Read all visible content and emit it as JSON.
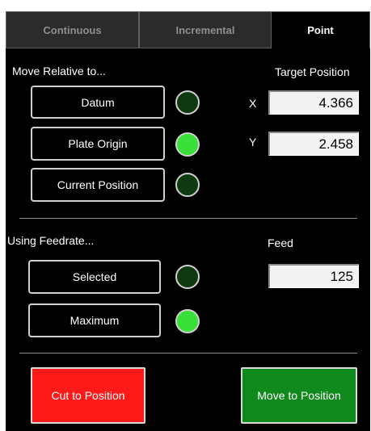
{
  "tabs": [
    {
      "label": "Continuous",
      "active": false
    },
    {
      "label": "Incremental",
      "active": false
    },
    {
      "label": "Point",
      "active": true
    }
  ],
  "move_relative": {
    "heading": "Move Relative to...",
    "options": [
      {
        "label": "Datum",
        "indicator": "off"
      },
      {
        "label": "Plate Origin",
        "indicator": "on"
      },
      {
        "label": "Current Position",
        "indicator": "off"
      }
    ]
  },
  "target_position": {
    "heading": "Target Position",
    "x_label": "X",
    "x_value": "4.366",
    "y_label": "Y",
    "y_value": "2.458"
  },
  "feedrate": {
    "heading": "Using Feedrate...",
    "options": [
      {
        "label": "Selected",
        "indicator": "off"
      },
      {
        "label": "Maximum",
        "indicator": "on"
      }
    ],
    "feed_label": "Feed",
    "feed_value": "125"
  },
  "actions": {
    "cut_label": "Cut to Position",
    "move_label": "Move to Position"
  },
  "colors": {
    "panel_bg": "#000000",
    "indicator_on": "#39e039",
    "indicator_off": "#0f3a10",
    "cut_button": "#ff1a1a",
    "move_button": "#118a1d"
  }
}
